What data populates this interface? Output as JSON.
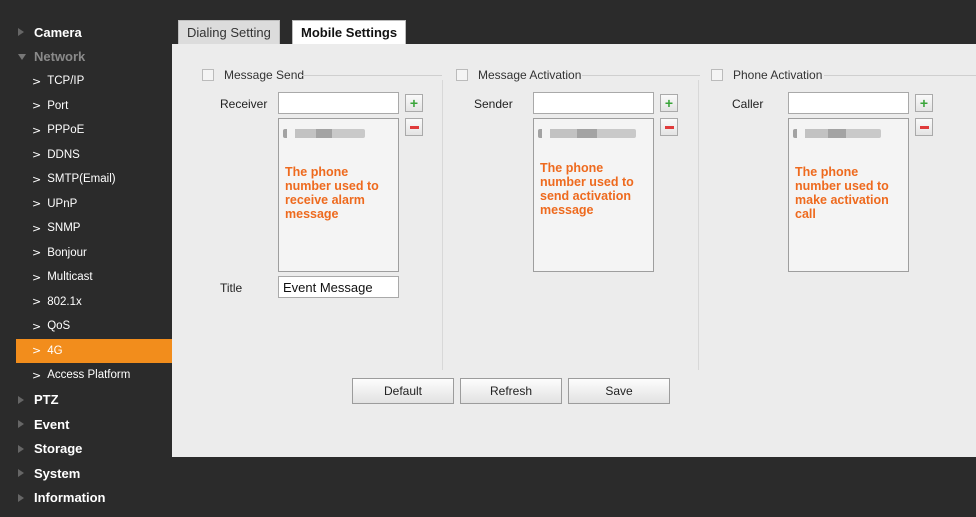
{
  "sidebar": {
    "camera": "Camera",
    "network": "Network",
    "network_items": [
      "TCP/IP",
      "Port",
      "PPPoE",
      "DDNS",
      "SMTP(Email)",
      "UPnP",
      "SNMP",
      "Bonjour",
      "Multicast",
      "802.1x",
      "QoS",
      "4G",
      "Access Platform"
    ],
    "active_item": "4G",
    "bottom_items": [
      "PTZ",
      "Event",
      "Storage",
      "System",
      "Information"
    ]
  },
  "tabs": {
    "dialing": "Dialing Setting",
    "mobile": "Mobile Settings"
  },
  "message_send": {
    "header": "Message Send",
    "receiver_label": "Receiver",
    "receiver_value": "",
    "note": "The phone number used to receive alarm message",
    "title_label": "Title",
    "title_value": "Event Message"
  },
  "message_activation": {
    "header": "Message Activation",
    "sender_label": "Sender",
    "sender_value": "",
    "note": "The phone number used to send activation message"
  },
  "phone_activation": {
    "header": "Phone Activation",
    "caller_label": "Caller",
    "caller_value": "",
    "note": "The phone number used to make activation call"
  },
  "buttons": {
    "default": "Default",
    "refresh": "Refresh",
    "save": "Save"
  },
  "colors": {
    "active_nav": "#f28d1c",
    "note_text": "#ee6a1e",
    "plus_icon": "#3aa53a",
    "minus_icon": "#e03b3b"
  }
}
